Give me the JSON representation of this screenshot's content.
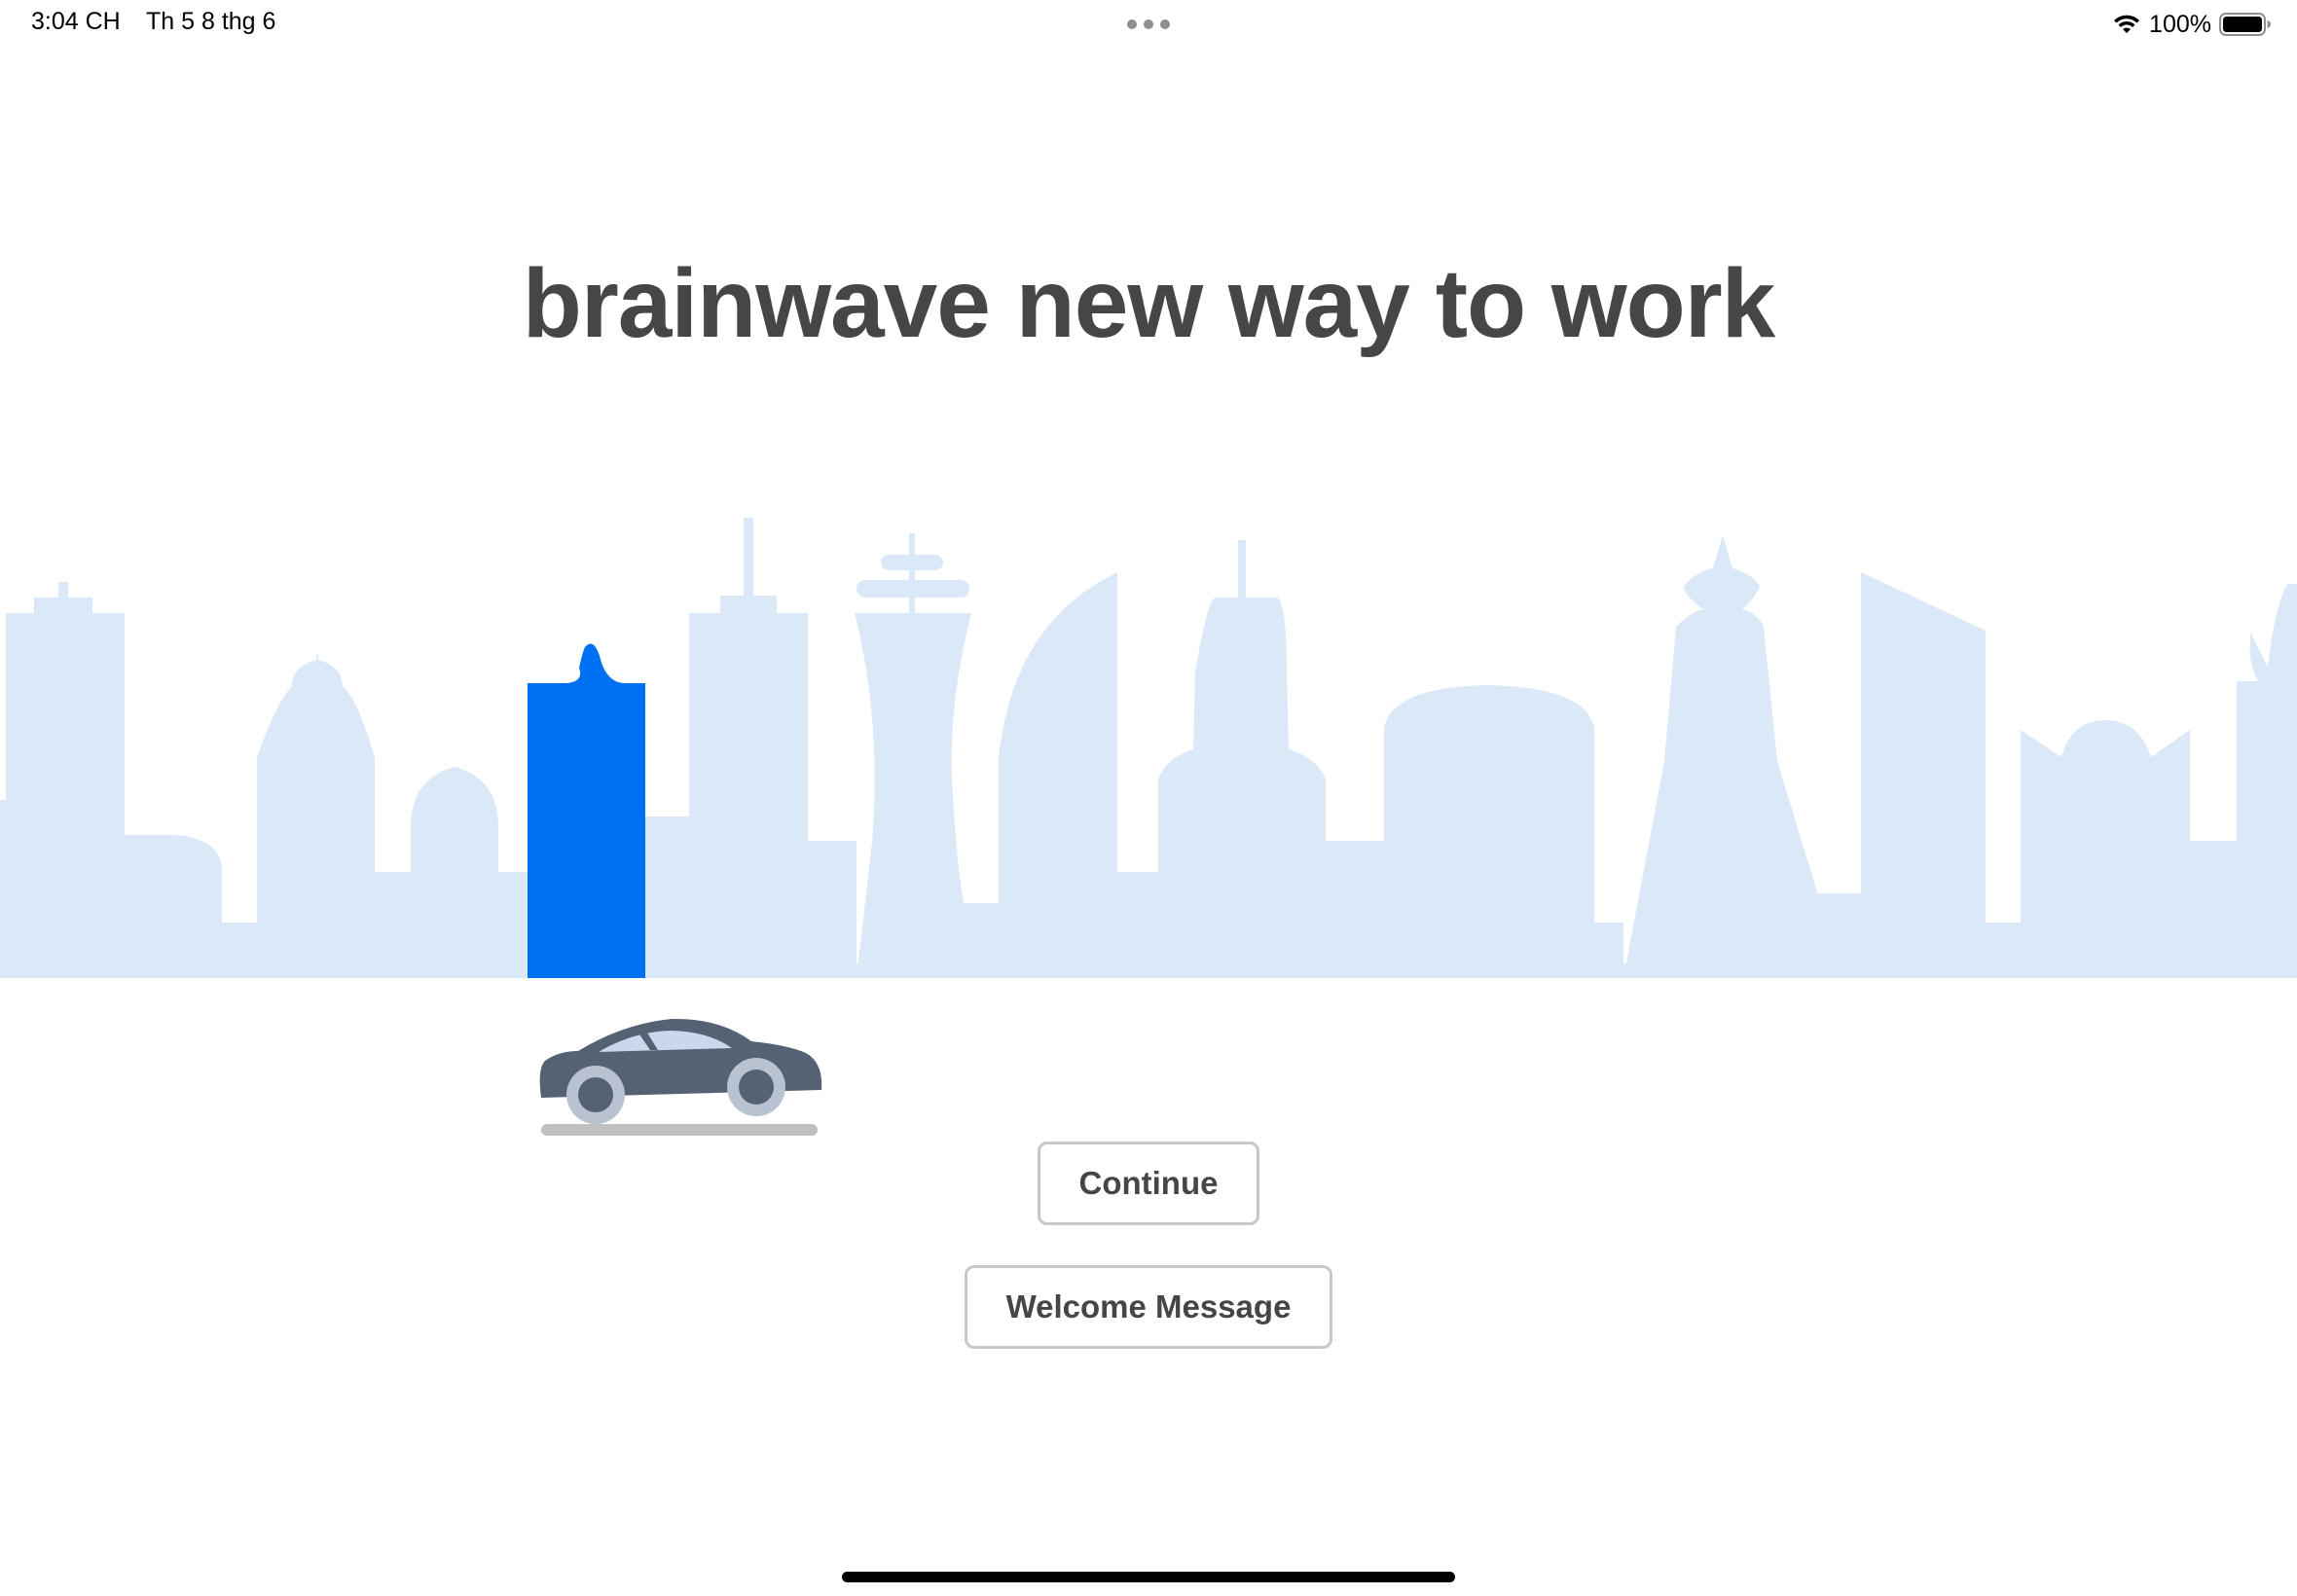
{
  "status_bar": {
    "time": "3:04 CH",
    "date": "Th 5 8 thg 6",
    "battery_percent": "100%",
    "battery_level": 1.0,
    "icons": [
      "wifi-icon",
      "battery-icon",
      "multitask-dots-icon"
    ]
  },
  "main": {
    "headline": "brainwave new way to work",
    "illustration": {
      "skyline_color": "#dbe8f8",
      "highlight_color": "#0070f3",
      "car_body_color": "#546274",
      "car_wheel_color": "#b8c2d0",
      "road_color": "#c0c0c0"
    },
    "buttons": {
      "continue_label": "Continue",
      "welcome_label": "Welcome Message"
    }
  },
  "colors": {
    "text_dark": "#464646",
    "button_border": "#c7c7cc",
    "background": "#ffffff"
  }
}
